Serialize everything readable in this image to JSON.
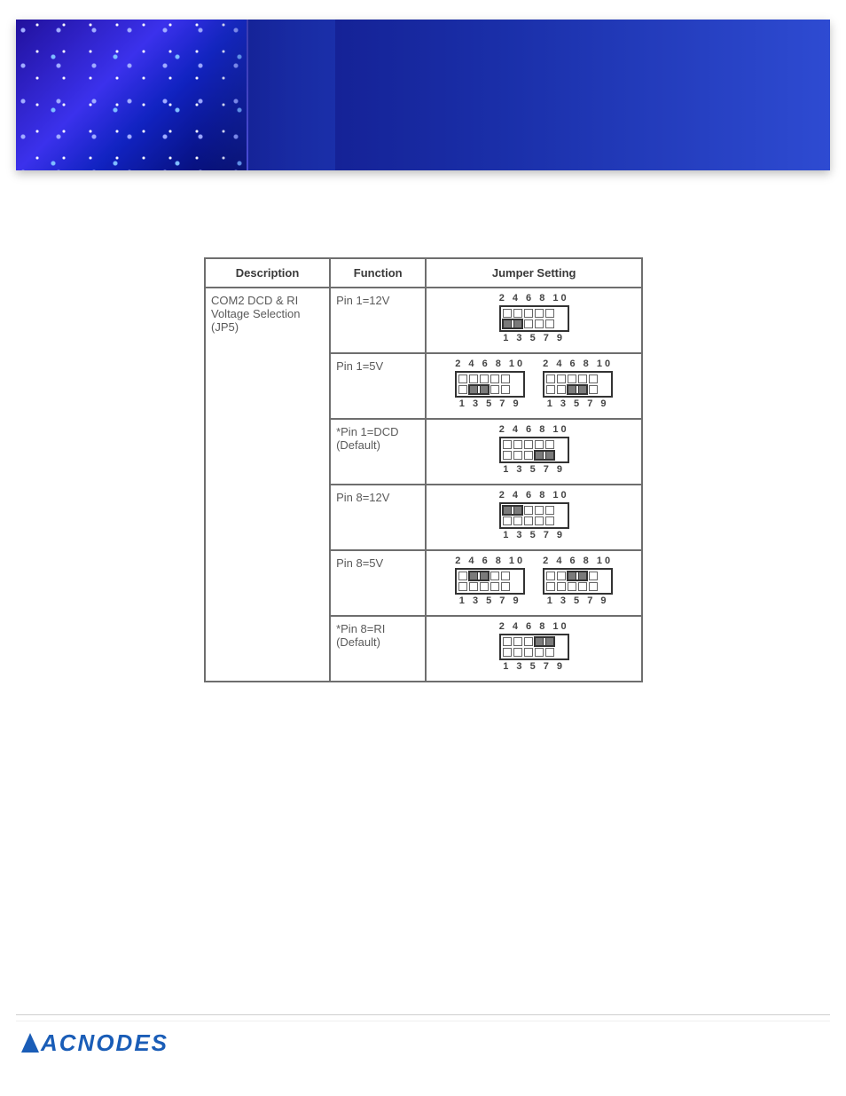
{
  "brand": {
    "name": "ACNODES"
  },
  "table": {
    "headers": {
      "description": "Description",
      "function": "Function",
      "jumper": "Jumper Setting"
    },
    "description": "COM2 DCD & RI Voltage Selection (JP5)",
    "pin_labels": {
      "top": "2 4 6 8 10",
      "bottom": "1 3 5 7 9"
    },
    "rows": [
      {
        "function": "Pin 1=12V",
        "blocks": [
          {
            "top_closed": [],
            "bottom_closed": [
              1,
              3
            ]
          }
        ]
      },
      {
        "function": "Pin 1=5V",
        "blocks": [
          {
            "top_closed": [],
            "bottom_closed": [
              3,
              5
            ]
          },
          {
            "top_closed": [],
            "bottom_closed": [
              5,
              7
            ]
          }
        ]
      },
      {
        "function": "*Pin 1=DCD\n(Default)",
        "blocks": [
          {
            "top_closed": [],
            "bottom_closed": [
              7,
              9
            ]
          }
        ]
      },
      {
        "function": "Pin 8=12V",
        "blocks": [
          {
            "top_closed": [
              2,
              4
            ],
            "bottom_closed": []
          }
        ]
      },
      {
        "function": "Pin 8=5V",
        "blocks": [
          {
            "top_closed": [
              4,
              6
            ],
            "bottom_closed": []
          },
          {
            "top_closed": [
              6,
              8
            ],
            "bottom_closed": []
          }
        ]
      },
      {
        "function": "*Pin 8=RI\n(Default)",
        "blocks": [
          {
            "top_closed": [
              8,
              10
            ],
            "bottom_closed": []
          }
        ]
      }
    ]
  }
}
